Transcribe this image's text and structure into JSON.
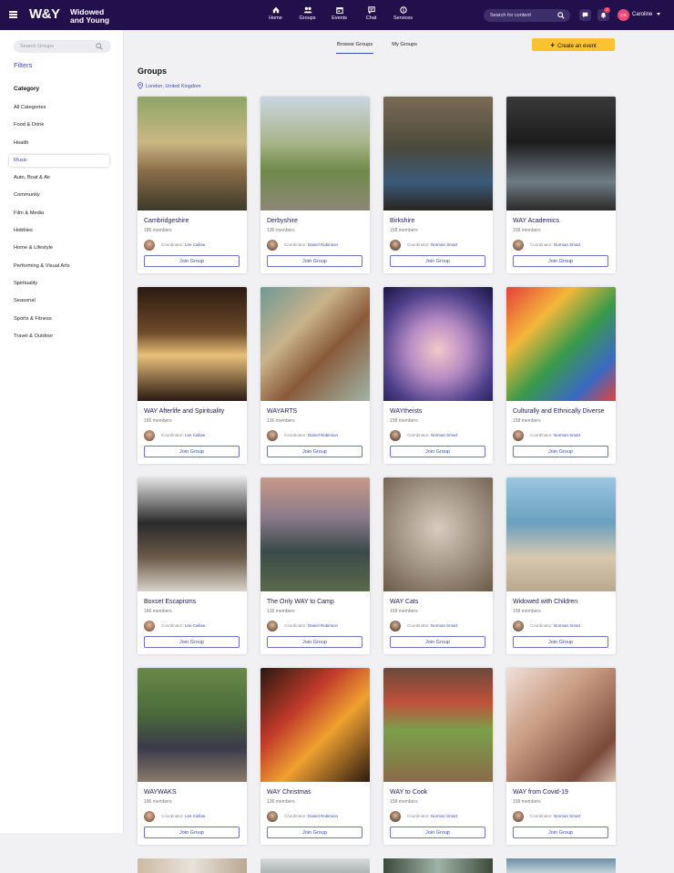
{
  "header": {
    "logo_mark": "W&Y",
    "logo_line1": "Widowed",
    "logo_line2": "and Young",
    "nav": [
      {
        "label": "Home",
        "icon": "home-icon"
      },
      {
        "label": "Groups",
        "icon": "groups-icon"
      },
      {
        "label": "Events",
        "icon": "events-icon"
      },
      {
        "label": "Chat",
        "icon": "chat-icon"
      },
      {
        "label": "Services",
        "icon": "services-icon"
      }
    ],
    "search_placeholder": "Search for content",
    "notification_count": "2",
    "user_initials": "CS",
    "user_name": "Caroline"
  },
  "sidebar": {
    "search_placeholder": "Search Groups",
    "filters_title": "Filters",
    "category_title": "Category",
    "categories": [
      "All Categories",
      "Food & Drink",
      "Health",
      "Music",
      "Auto, Boat & Air",
      "Community",
      "Film & Media",
      "Hobbies",
      "Home & Lifestyle",
      "Performing & Visual Arts",
      "Spirituality",
      "Seasonal",
      "Sports & Fitness",
      "Travel & Outdoor"
    ],
    "active_category": "Music"
  },
  "main": {
    "tabs": [
      {
        "label": "Browse Groups",
        "active": true
      },
      {
        "label": "My Groups",
        "active": false
      }
    ],
    "create_button": "Create an event",
    "title": "Groups",
    "location": "London, United Kingdom",
    "coordinator_prefix": "Coordinator:",
    "join_label": "Join Group",
    "groups": [
      {
        "name": "Cambridgeshire",
        "members": "186 members",
        "coordinator": "Lee Callow"
      },
      {
        "name": "Derbyshire",
        "members": "136 members",
        "coordinator": "Daniel Robinson"
      },
      {
        "name": "Birkshire",
        "members": "158 members",
        "coordinator": "Norman Smart"
      },
      {
        "name": "WAY Academics",
        "members": "158 members",
        "coordinator": "Norman Smart"
      },
      {
        "name": "WAY Afterlife and Spirituality",
        "members": "186 members",
        "coordinator": "Lee Callow"
      },
      {
        "name": "WAYARTS",
        "members": "136 members",
        "coordinator": "Daniel Robinson"
      },
      {
        "name": "WAYtheists",
        "members": "158 members",
        "coordinator": "Norman Smart"
      },
      {
        "name": "Culturally and Ethnically Diverse",
        "members": "158 members",
        "coordinator": "Norman Smart"
      },
      {
        "name": "Boxset Escapisms",
        "members": "186 members",
        "coordinator": "Lee Callow"
      },
      {
        "name": "The Only WAY to Camp",
        "members": "136 members",
        "coordinator": "Daniel Robinson"
      },
      {
        "name": "WAY Cats",
        "members": "158 members",
        "coordinator": "Norman Smart"
      },
      {
        "name": "Widowed with Children",
        "members": "158 members",
        "coordinator": "Norman Smart"
      },
      {
        "name": "WAYWAKS",
        "members": "186 members",
        "coordinator": "Lee Callow"
      },
      {
        "name": "WAY Christmas",
        "members": "136 members",
        "coordinator": "Daniel Robinson"
      },
      {
        "name": "WAY to Cook",
        "members": "158 members",
        "coordinator": "Norman Smart"
      },
      {
        "name": "WAY from Covid-19",
        "members": "158 members",
        "coordinator": "Norman Smart"
      }
    ]
  },
  "colors": {
    "header_bg": "#22104d",
    "accent": "#3b4ab8",
    "create_button": "#f9c230"
  }
}
